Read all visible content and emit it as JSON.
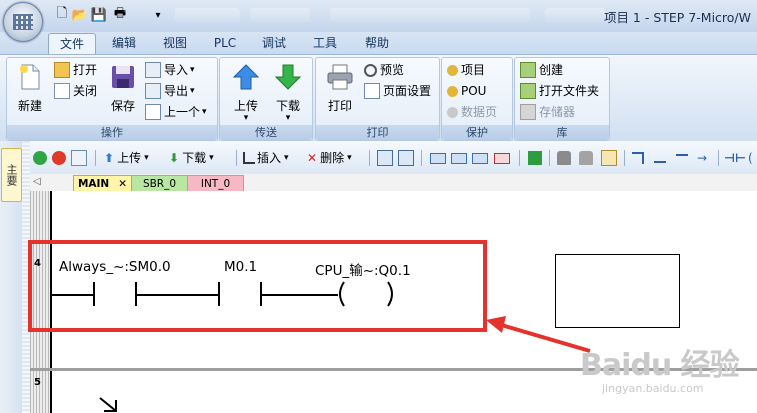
{
  "window": {
    "title": "项目 1 - STEP 7-Micro/W"
  },
  "ribbon": {
    "tabs": [
      "文件",
      "编辑",
      "视图",
      "PLC",
      "调试",
      "工具",
      "帮助"
    ],
    "active_tab": "文件",
    "groups": {
      "operations": {
        "label": "操作",
        "new": "新建",
        "open": "打开",
        "close": "关闭",
        "save": "保存",
        "import": "导入",
        "export": "导出",
        "previous": "上一个"
      },
      "transfer": {
        "label": "传送",
        "upload": "上传",
        "download": "下载"
      },
      "print": {
        "label": "打印",
        "print": "打印",
        "preview": "预览",
        "page_setup": "页面设置"
      },
      "protect": {
        "label": "保护",
        "project": "项目",
        "pou": "POU",
        "data_page": "数据页"
      },
      "library": {
        "label": "库",
        "create": "创建",
        "open_folder": "打开文件夹",
        "memory": "存储器"
      }
    }
  },
  "side_pane": {
    "tab": "主要"
  },
  "toolbar": {
    "upload": "上传",
    "download": "下载",
    "insert": "插入",
    "delete": "删除"
  },
  "doc_tabs": [
    "MAIN",
    "SBR_0",
    "INT_0"
  ],
  "ladder": {
    "networks": [
      {
        "number": "4",
        "contacts": [
          {
            "operand": "Always_~:SM0.0",
            "type": "normally-open"
          },
          {
            "operand": "M0.1",
            "type": "normally-open"
          }
        ],
        "coil": {
          "operand": "CPU_输~:Q0.1"
        }
      },
      {
        "number": "5"
      }
    ]
  },
  "watermark": {
    "text": "Baidu 经验",
    "url": "jingyan.baidu.com"
  },
  "colors": {
    "highlight": "#e5322d",
    "arrow": "#e5322d"
  }
}
